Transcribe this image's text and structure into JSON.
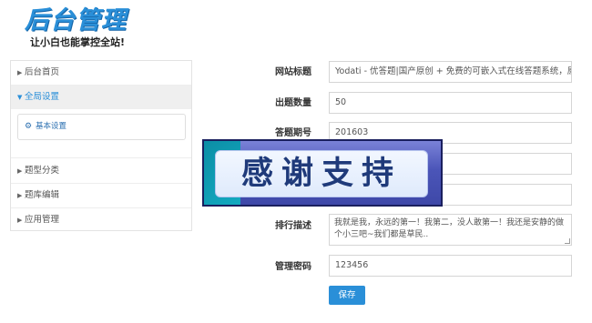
{
  "logo": {
    "title": "后台管理",
    "subtitle": "让小白也能掌控全站!"
  },
  "sidebar": {
    "items": [
      {
        "label": "后台首页",
        "expanded": false
      },
      {
        "label": "全局设置",
        "expanded": true
      },
      {
        "label": "题型分类",
        "expanded": false
      },
      {
        "label": "题库编辑",
        "expanded": false
      },
      {
        "label": "应用管理",
        "expanded": false
      }
    ],
    "submenu": [
      {
        "label": "基本设置",
        "icon": "gear-icon"
      }
    ]
  },
  "form": {
    "site_title": {
      "label": "网站标题",
      "value": "Yodati - 优答题|国产原创 + 免费的可嵌入式在线答题系统，原"
    },
    "question_count": {
      "label": "出题数量",
      "value": "50"
    },
    "question_period": {
      "label": "答题期号",
      "value": "201603"
    },
    "ranking_desc": {
      "label": "排行描述",
      "value": "我就是我，永远的第一！我第二，没人敢第一！我还是安静的做个小三吧~我们都是草民.."
    },
    "admin_password": {
      "label": "管理密码",
      "value": "123456"
    },
    "save_label": "保存"
  },
  "overlay": {
    "text": "感谢支持"
  },
  "colors": {
    "accent": "#2a8fd8",
    "banner": "#4b55b8"
  }
}
